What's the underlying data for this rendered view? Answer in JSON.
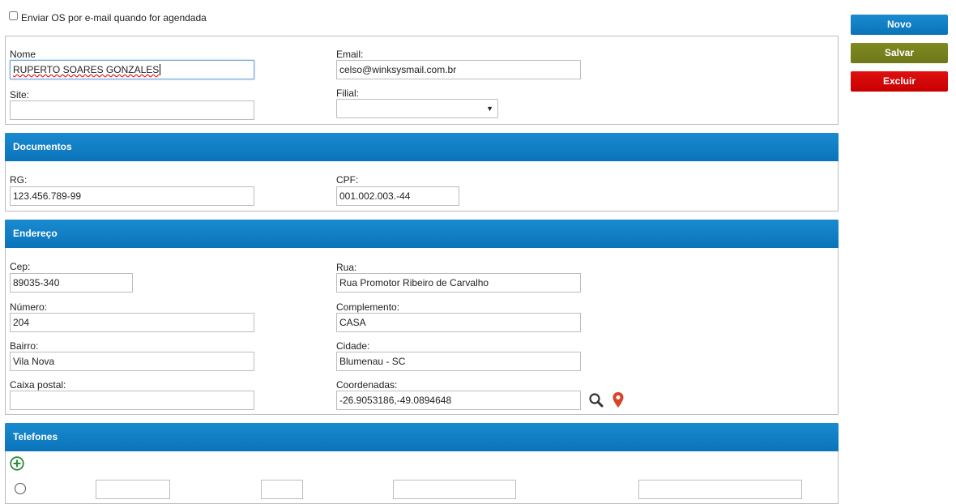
{
  "email_option": {
    "label": "Enviar OS por e-mail quando for agendada"
  },
  "actions": {
    "novo": "Novo",
    "salvar": "Salvar",
    "excluir": "Excluir"
  },
  "cliente": {
    "nome_label": "Nome",
    "nome_value": "RUPERTO SOARES GONZALES",
    "email_label": "Email:",
    "email_value": "celso@winksysmail.com.br",
    "site_label": "Site:",
    "site_value": "",
    "filial_label": "Filial:",
    "filial_value": ""
  },
  "documentos": {
    "title": "Documentos",
    "rg_label": "RG:",
    "rg_value": "123.456.789-99",
    "cpf_label": "CPF:",
    "cpf_value": "001.002.003.-44"
  },
  "endereco": {
    "title": "Endereço",
    "cep_label": "Cep:",
    "cep_value": "89035-340",
    "rua_label": "Rua:",
    "rua_value": "Rua Promotor Ribeiro de Carvalho",
    "numero_label": "Número:",
    "numero_value": "204",
    "complemento_label": "Complemento:",
    "complemento_value": "CASA",
    "bairro_label": "Bairro:",
    "bairro_value": "Vila Nova",
    "cidade_label": "Cidade:",
    "cidade_value": "Blumenau - SC",
    "caixa_label": "Caixa postal:",
    "caixa_value": "",
    "coord_label": "Coordenadas:",
    "coord_value": "-26.9053186,-49.0894648"
  },
  "telefones": {
    "title": "Telefones"
  },
  "icons": {
    "search": "search-icon",
    "map_pin": "map-pin-icon",
    "add": "add-circle-icon"
  },
  "colors": {
    "header_blue": "#0f7ec4",
    "salvar": "#737e1c",
    "excluir": "#cc0000",
    "pin": "#d9452b",
    "add": "#2e8b3a"
  }
}
